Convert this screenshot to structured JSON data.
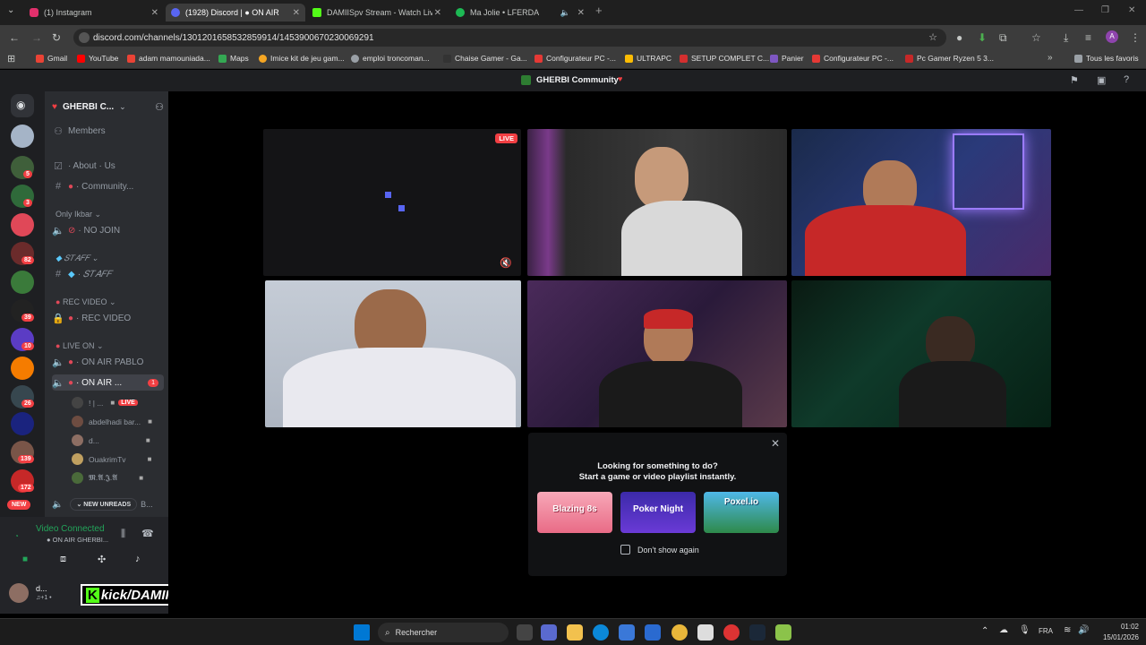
{
  "browser": {
    "tabs": [
      {
        "title": "(1) Instagram",
        "active": false,
        "color": "#e1306c"
      },
      {
        "title": "(1928) Discord | ● ON AIR",
        "active": true,
        "color": "#5865f2"
      },
      {
        "title": "DAMIISpv Stream - Watch Live",
        "active": false,
        "color": "#53fc18"
      },
      {
        "title": "Ma Jolie • LFERDA",
        "active": false,
        "color": "#1db954"
      }
    ],
    "url": "discord.com/channels/1301201658532859914/1453900670230069291",
    "bookmarks": [
      {
        "label": "Gmail",
        "color": "#ea4335"
      },
      {
        "label": "YouTube",
        "color": "#ff0000"
      },
      {
        "label": "adam mamouniada...",
        "color": "#ea4335"
      },
      {
        "label": "Maps",
        "color": "#34a853"
      },
      {
        "label": "Imice kit de jeu gam...",
        "color": "#f5a623"
      },
      {
        "label": "emploi troncoman...",
        "color": "#9aa0a6"
      },
      {
        "label": "Chaise Gamer - Ga...",
        "color": "#333333"
      },
      {
        "label": "Configurateur PC -...",
        "color": "#e53935"
      },
      {
        "label": "ULTRAPC",
        "color": "#fbbc04"
      },
      {
        "label": "SETUP COMPLET C...",
        "color": "#d32f2f"
      },
      {
        "label": "Panier",
        "color": "#7e57c2"
      },
      {
        "label": "Configurateur PC -...",
        "color": "#e53935"
      },
      {
        "label": "Pc Gamer Ryzen 5 3...",
        "color": "#c62828"
      }
    ],
    "all_bookmarks_label": "Tous les favoris"
  },
  "discord": {
    "window_title": "GHERBI Community",
    "server_name": "GHERBI C...",
    "members_label": "Members",
    "channels": [
      {
        "icon": "rules",
        "label": "· About · Us"
      },
      {
        "icon": "hash",
        "label": "· Community..."
      },
      {
        "icon": "category",
        "label": "Only Ikbar"
      },
      {
        "icon": "voice",
        "label": "· NO JOIN"
      },
      {
        "icon": "category",
        "label": "𝑆𝑇𝐴𝐹𝐹"
      },
      {
        "icon": "hash",
        "label": "· 𝑆𝑇𝐴𝐹𝐹"
      },
      {
        "icon": "category",
        "label": "REC VIDEO"
      },
      {
        "icon": "lock",
        "label": "· REC VIDEO"
      },
      {
        "icon": "category",
        "label": "LIVE ON"
      },
      {
        "icon": "voice",
        "label": "· ON AIR PABLO"
      },
      {
        "icon": "voice",
        "label": "· ON AIR ..."
      }
    ],
    "active_channel_count": "1",
    "voice_users": [
      {
        "name": "! | ...",
        "live": true
      },
      {
        "name": "abdelhadi bar...",
        "live": false
      },
      {
        "name": "d...",
        "live": false
      },
      {
        "name": "OuakrimTv",
        "live": false
      },
      {
        "name": "𝕸.𝕬.𝕵.𝕬",
        "live": false
      }
    ],
    "live_label": "LIVE",
    "new_unreads_label": "NEW UNREADS",
    "new_unreads_tail": "B...",
    "new_badge": "NEW",
    "server_badges": [
      "5",
      "3",
      "82",
      "39",
      "10",
      "26",
      "139",
      "172"
    ],
    "voice_status": "Video Connected",
    "voice_channel": "● ON AIR GHERBI...",
    "user_name": "d...",
    "user_status": "♫+1 •",
    "overlay_text": "kick/DAMIISpv",
    "popup": {
      "title": "Looking for something to do?",
      "subtitle": "Start a game or video playlist instantly.",
      "games": [
        "Blazing 8s",
        "Poker Night",
        "Poxel.io"
      ],
      "dont_show": "Don't show again"
    }
  },
  "taskbar": {
    "search_label": "Rechercher",
    "lang": "FRA",
    "time": "01:02",
    "date": "15/01/2026"
  }
}
